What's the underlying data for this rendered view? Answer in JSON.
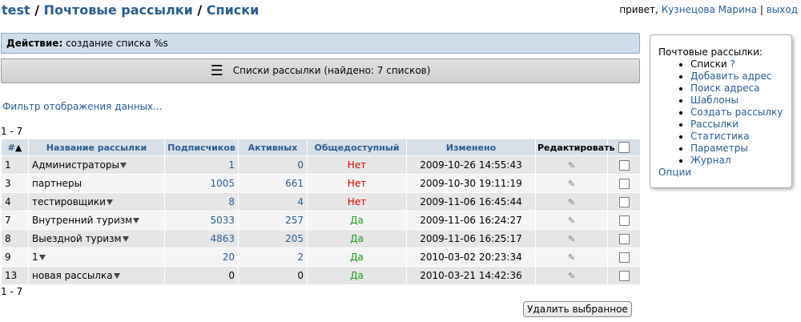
{
  "breadcrumb": {
    "root": "test",
    "sep": " / ",
    "section": "Почтовые рассылки",
    "page": "Списки"
  },
  "user": {
    "greeting": "привет,",
    "name": "Кузнецова Марина",
    "sep": "|",
    "logout": "выход"
  },
  "action": {
    "label": "Действие:",
    "text": "создание списка %s"
  },
  "lists_bar": {
    "icon": "menu-icon",
    "title": "Списки рассылки (найдено: 7 списков)"
  },
  "filter_link": "Фильтр отображения данных...",
  "range": "1 - 7",
  "table": {
    "headers": {
      "id": "#",
      "name": "Название рассылки",
      "subscribers": "Подписчиков",
      "active": "Активных",
      "public": "Общедоступный",
      "modified": "Изменено",
      "edit": "Редактировать"
    },
    "sort_indicator": "▲",
    "rows": [
      {
        "id": "1",
        "name": "Администраторы",
        "subscribers": "1",
        "active": "0",
        "public": "Нет",
        "modified": "2009-10-26 14:55:43"
      },
      {
        "id": "3",
        "name": "партнеры",
        "subscribers": "1005",
        "active": "661",
        "public": "Нет",
        "modified": "2009-10-30 19:11:19"
      },
      {
        "id": "4",
        "name": "тестировщики",
        "subscribers": "8",
        "active": "4",
        "public": "Нет",
        "modified": "2009-11-06 16:45:44"
      },
      {
        "id": "7",
        "name": "Внутренний туризм",
        "subscribers": "5033",
        "active": "257",
        "public": "Да",
        "modified": "2009-11-06 16:24:27"
      },
      {
        "id": "8",
        "name": "Выездной туризм",
        "subscribers": "4863",
        "active": "205",
        "public": "Да",
        "modified": "2009-11-06 16:25:17"
      },
      {
        "id": "9",
        "name": "1",
        "subscribers": "20",
        "active": "2",
        "public": "Да",
        "modified": "2010-03-02 20:23:34"
      },
      {
        "id": "13",
        "name": "новая рассылка",
        "subscribers": "0",
        "active": "0",
        "public": "Да",
        "modified": "2010-03-21 14:42:36"
      }
    ]
  },
  "delete_button": "Удалить выбранное",
  "sidebox": {
    "title": "Почтовые рассылки:",
    "current": "Списки",
    "help": "?",
    "items": [
      "Добавить адрес",
      "Поиск адреса",
      "Шаблоны",
      "Создать рассылку",
      "Рассылки",
      "Статистика",
      "Параметры",
      "Журнал"
    ],
    "options": "Опции"
  },
  "colors": {
    "link": "#2a5d8f",
    "no": "#d60000",
    "yes": "#1a9a1a",
    "header_bg": "#d9dfe7",
    "action_bg": "#cfdcea"
  }
}
